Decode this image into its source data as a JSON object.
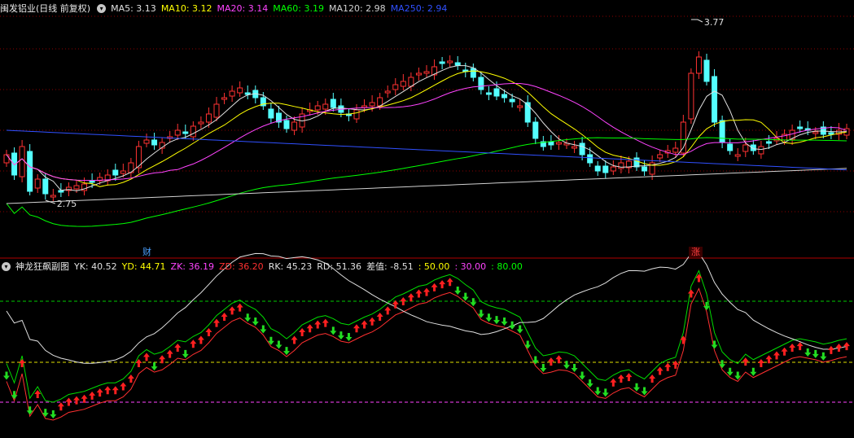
{
  "main_header": {
    "title": "闽发铝业(日线 前复权)",
    "indicators": [
      {
        "label": "MA5: 3.13",
        "color": "#e0e0e0"
      },
      {
        "label": "MA10: 3.12",
        "color": "#ffff00"
      },
      {
        "label": "MA20: 3.14",
        "color": "#ff44ff"
      },
      {
        "label": "MA60: 3.19",
        "color": "#00ff00"
      },
      {
        "label": "MA120: 2.98",
        "color": "#d0d0d0"
      },
      {
        "label": "MA250: 2.94",
        "color": "#3050ff"
      }
    ]
  },
  "main_chart": {
    "high_marker": "3.77",
    "low_marker": "2.75",
    "badges": [
      {
        "label": "财",
        "color": "#4aa0ff"
      },
      {
        "label": "涨",
        "color": "#ff4040"
      }
    ]
  },
  "sub_header": {
    "title": "神龙狂飙副图",
    "values": [
      {
        "label": "YK: 40.52",
        "color": "#e0e0e0"
      },
      {
        "label": "YD: 44.71",
        "color": "#ffff00"
      },
      {
        "label": "ZK: 36.19",
        "color": "#ff44ff"
      },
      {
        "label": "ZD: 36.20",
        "color": "#ff3030"
      },
      {
        "label": "RK: 45.23",
        "color": "#e0e0e0"
      },
      {
        "label": "RD: 51.36",
        "color": "#e0e0e0"
      },
      {
        "label": "差值: -8.51",
        "color": "#e0e0e0"
      },
      {
        "label": ": 50.00",
        "color": "#ffff00"
      },
      {
        "label": ": 30.00",
        "color": "#ff44ff"
      },
      {
        "label": ": 80.00",
        "color": "#00ff00"
      }
    ]
  },
  "colors": {
    "up_candle": "#ff3232",
    "down_candle": "#54ffff",
    "grid": "#8b0000",
    "up_arrow": "#ff2020",
    "down_arrow": "#22dd22"
  }
}
